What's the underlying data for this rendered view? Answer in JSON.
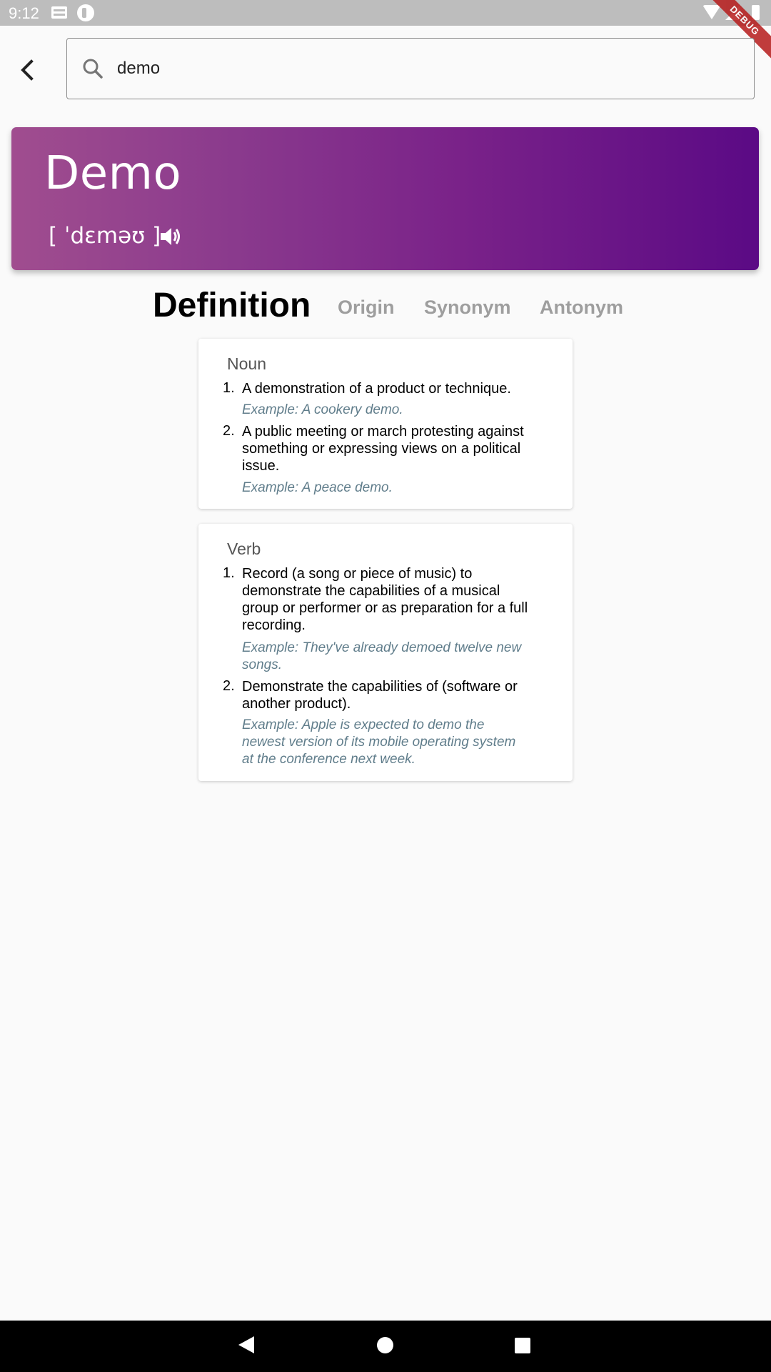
{
  "status_bar": {
    "time": "9:12"
  },
  "debug_banner": "DEBUG",
  "search": {
    "value": "demo",
    "placeholder": ""
  },
  "word": {
    "title": "Demo",
    "phonetic": "[ ˈdɛməʊ ]"
  },
  "tabs": [
    {
      "label": "Definition",
      "active": true
    },
    {
      "label": "Origin",
      "active": false
    },
    {
      "label": "Synonym",
      "active": false
    },
    {
      "label": "Antonym",
      "active": false
    }
  ],
  "definitions": [
    {
      "part_of_speech": "Noun",
      "senses": [
        {
          "num": "1.",
          "lines": [
            "A demonstration of a product or technique."
          ],
          "example": [
            "Example: A cookery demo."
          ]
        },
        {
          "num": "2.",
          "lines": [
            "A public meeting or march protesting against",
            "something or expressing views on a political",
            "issue."
          ],
          "example": [
            "Example: A peace demo."
          ]
        }
      ]
    },
    {
      "part_of_speech": "Verb",
      "senses": [
        {
          "num": "1.",
          "lines": [
            "Record (a song or piece of music) to",
            "demonstrate the capabilities of a musical",
            "group or performer or as preparation for a full",
            "recording."
          ],
          "example": [
            "Example: They've already demoed twelve new",
            "songs."
          ]
        },
        {
          "num": "2.",
          "lines": [
            "Demonstrate the capabilities of (software or",
            "another product)."
          ],
          "example": [
            "Example: Apple is expected to demo the",
            "newest version of its mobile operating system",
            "at the conference next week."
          ]
        }
      ]
    }
  ],
  "colors": {
    "hero_gradient_start": "#a04d8f",
    "hero_gradient_end": "#5b0a85",
    "example_text": "#607d8b",
    "inactive_tab": "#9e9e9e"
  }
}
